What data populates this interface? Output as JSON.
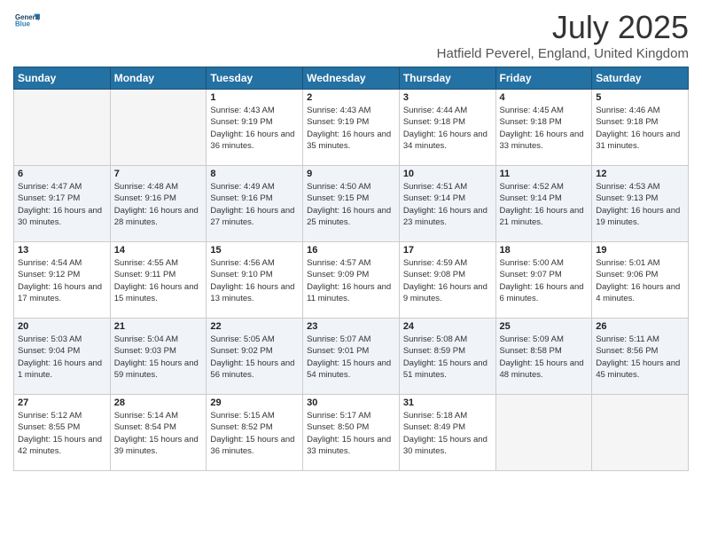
{
  "logo": {
    "line1": "General",
    "line2": "Blue"
  },
  "title": "July 2025",
  "location": "Hatfield Peverel, England, United Kingdom",
  "days_of_week": [
    "Sunday",
    "Monday",
    "Tuesday",
    "Wednesday",
    "Thursday",
    "Friday",
    "Saturday"
  ],
  "weeks": [
    [
      {
        "day": "",
        "info": ""
      },
      {
        "day": "",
        "info": ""
      },
      {
        "day": "1",
        "info": "Sunrise: 4:43 AM\nSunset: 9:19 PM\nDaylight: 16 hours and 36 minutes."
      },
      {
        "day": "2",
        "info": "Sunrise: 4:43 AM\nSunset: 9:19 PM\nDaylight: 16 hours and 35 minutes."
      },
      {
        "day": "3",
        "info": "Sunrise: 4:44 AM\nSunset: 9:18 PM\nDaylight: 16 hours and 34 minutes."
      },
      {
        "day": "4",
        "info": "Sunrise: 4:45 AM\nSunset: 9:18 PM\nDaylight: 16 hours and 33 minutes."
      },
      {
        "day": "5",
        "info": "Sunrise: 4:46 AM\nSunset: 9:18 PM\nDaylight: 16 hours and 31 minutes."
      }
    ],
    [
      {
        "day": "6",
        "info": "Sunrise: 4:47 AM\nSunset: 9:17 PM\nDaylight: 16 hours and 30 minutes."
      },
      {
        "day": "7",
        "info": "Sunrise: 4:48 AM\nSunset: 9:16 PM\nDaylight: 16 hours and 28 minutes."
      },
      {
        "day": "8",
        "info": "Sunrise: 4:49 AM\nSunset: 9:16 PM\nDaylight: 16 hours and 27 minutes."
      },
      {
        "day": "9",
        "info": "Sunrise: 4:50 AM\nSunset: 9:15 PM\nDaylight: 16 hours and 25 minutes."
      },
      {
        "day": "10",
        "info": "Sunrise: 4:51 AM\nSunset: 9:14 PM\nDaylight: 16 hours and 23 minutes."
      },
      {
        "day": "11",
        "info": "Sunrise: 4:52 AM\nSunset: 9:14 PM\nDaylight: 16 hours and 21 minutes."
      },
      {
        "day": "12",
        "info": "Sunrise: 4:53 AM\nSunset: 9:13 PM\nDaylight: 16 hours and 19 minutes."
      }
    ],
    [
      {
        "day": "13",
        "info": "Sunrise: 4:54 AM\nSunset: 9:12 PM\nDaylight: 16 hours and 17 minutes."
      },
      {
        "day": "14",
        "info": "Sunrise: 4:55 AM\nSunset: 9:11 PM\nDaylight: 16 hours and 15 minutes."
      },
      {
        "day": "15",
        "info": "Sunrise: 4:56 AM\nSunset: 9:10 PM\nDaylight: 16 hours and 13 minutes."
      },
      {
        "day": "16",
        "info": "Sunrise: 4:57 AM\nSunset: 9:09 PM\nDaylight: 16 hours and 11 minutes."
      },
      {
        "day": "17",
        "info": "Sunrise: 4:59 AM\nSunset: 9:08 PM\nDaylight: 16 hours and 9 minutes."
      },
      {
        "day": "18",
        "info": "Sunrise: 5:00 AM\nSunset: 9:07 PM\nDaylight: 16 hours and 6 minutes."
      },
      {
        "day": "19",
        "info": "Sunrise: 5:01 AM\nSunset: 9:06 PM\nDaylight: 16 hours and 4 minutes."
      }
    ],
    [
      {
        "day": "20",
        "info": "Sunrise: 5:03 AM\nSunset: 9:04 PM\nDaylight: 16 hours and 1 minute."
      },
      {
        "day": "21",
        "info": "Sunrise: 5:04 AM\nSunset: 9:03 PM\nDaylight: 15 hours and 59 minutes."
      },
      {
        "day": "22",
        "info": "Sunrise: 5:05 AM\nSunset: 9:02 PM\nDaylight: 15 hours and 56 minutes."
      },
      {
        "day": "23",
        "info": "Sunrise: 5:07 AM\nSunset: 9:01 PM\nDaylight: 15 hours and 54 minutes."
      },
      {
        "day": "24",
        "info": "Sunrise: 5:08 AM\nSunset: 8:59 PM\nDaylight: 15 hours and 51 minutes."
      },
      {
        "day": "25",
        "info": "Sunrise: 5:09 AM\nSunset: 8:58 PM\nDaylight: 15 hours and 48 minutes."
      },
      {
        "day": "26",
        "info": "Sunrise: 5:11 AM\nSunset: 8:56 PM\nDaylight: 15 hours and 45 minutes."
      }
    ],
    [
      {
        "day": "27",
        "info": "Sunrise: 5:12 AM\nSunset: 8:55 PM\nDaylight: 15 hours and 42 minutes."
      },
      {
        "day": "28",
        "info": "Sunrise: 5:14 AM\nSunset: 8:54 PM\nDaylight: 15 hours and 39 minutes."
      },
      {
        "day": "29",
        "info": "Sunrise: 5:15 AM\nSunset: 8:52 PM\nDaylight: 15 hours and 36 minutes."
      },
      {
        "day": "30",
        "info": "Sunrise: 5:17 AM\nSunset: 8:50 PM\nDaylight: 15 hours and 33 minutes."
      },
      {
        "day": "31",
        "info": "Sunrise: 5:18 AM\nSunset: 8:49 PM\nDaylight: 15 hours and 30 minutes."
      },
      {
        "day": "",
        "info": ""
      },
      {
        "day": "",
        "info": ""
      }
    ]
  ]
}
